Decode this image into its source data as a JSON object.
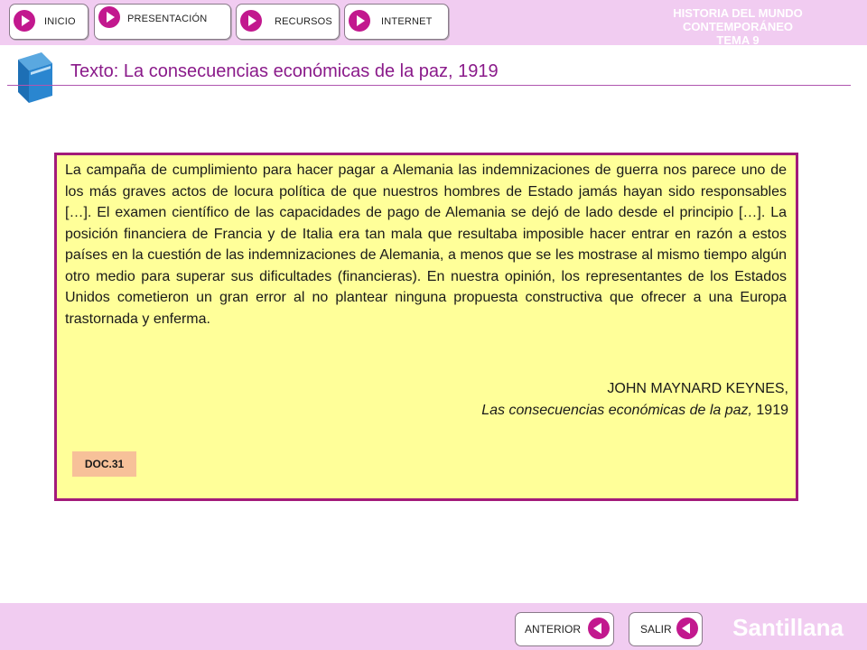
{
  "nav": {
    "inicio": "INICIO",
    "presentacion": "PRESENTACIÓN",
    "recursos": "RECURSOS",
    "internet": "INTERNET"
  },
  "header": {
    "line1": "HISTORIA DEL MUNDO CONTEMPORÁNEO",
    "line2": "TEMA 9"
  },
  "page": {
    "title": "Texto: La consecuencias económicas de la paz, 1919"
  },
  "document": {
    "body": "La campaña de cumplimiento para hacer pagar a Alemania las indemnizaciones de guerra nos parece uno de los más graves actos de locura política de que nuestros hombres de Estado jamás hayan sido responsables […]. El examen científico de las capacidades de pago de Alemania se dejó de lado desde el principio […]. La posición financiera de Francia y de Italia era tan mala que resultaba imposible hacer entrar en razón a estos países en la cuestión de las indemnizaciones de Alemania, a menos que se les mostrase al mismo tiempo algún otro medio para superar sus dificultades (financieras). En nuestra opinión, los representantes de los Estados Unidos cometieron un gran error al no plantear ninguna propuesta constructiva que ofrecer a una Europa trastornada y enferma.",
    "author": "JOHN MAYNARD KEYNES,",
    "book_title": "Las consecuencias económicas de la paz,",
    "year": "1919",
    "tag": "DOC.31"
  },
  "footer": {
    "anterior": "ANTERIOR",
    "salir": "SALIR",
    "brand": "Santillana"
  },
  "colors": {
    "bar_bg": "#f1ccf1",
    "accent": "#c2188e",
    "doc_bg": "#ffff99",
    "doc_border": "#a31a7a",
    "title": "#8a1a8a"
  }
}
